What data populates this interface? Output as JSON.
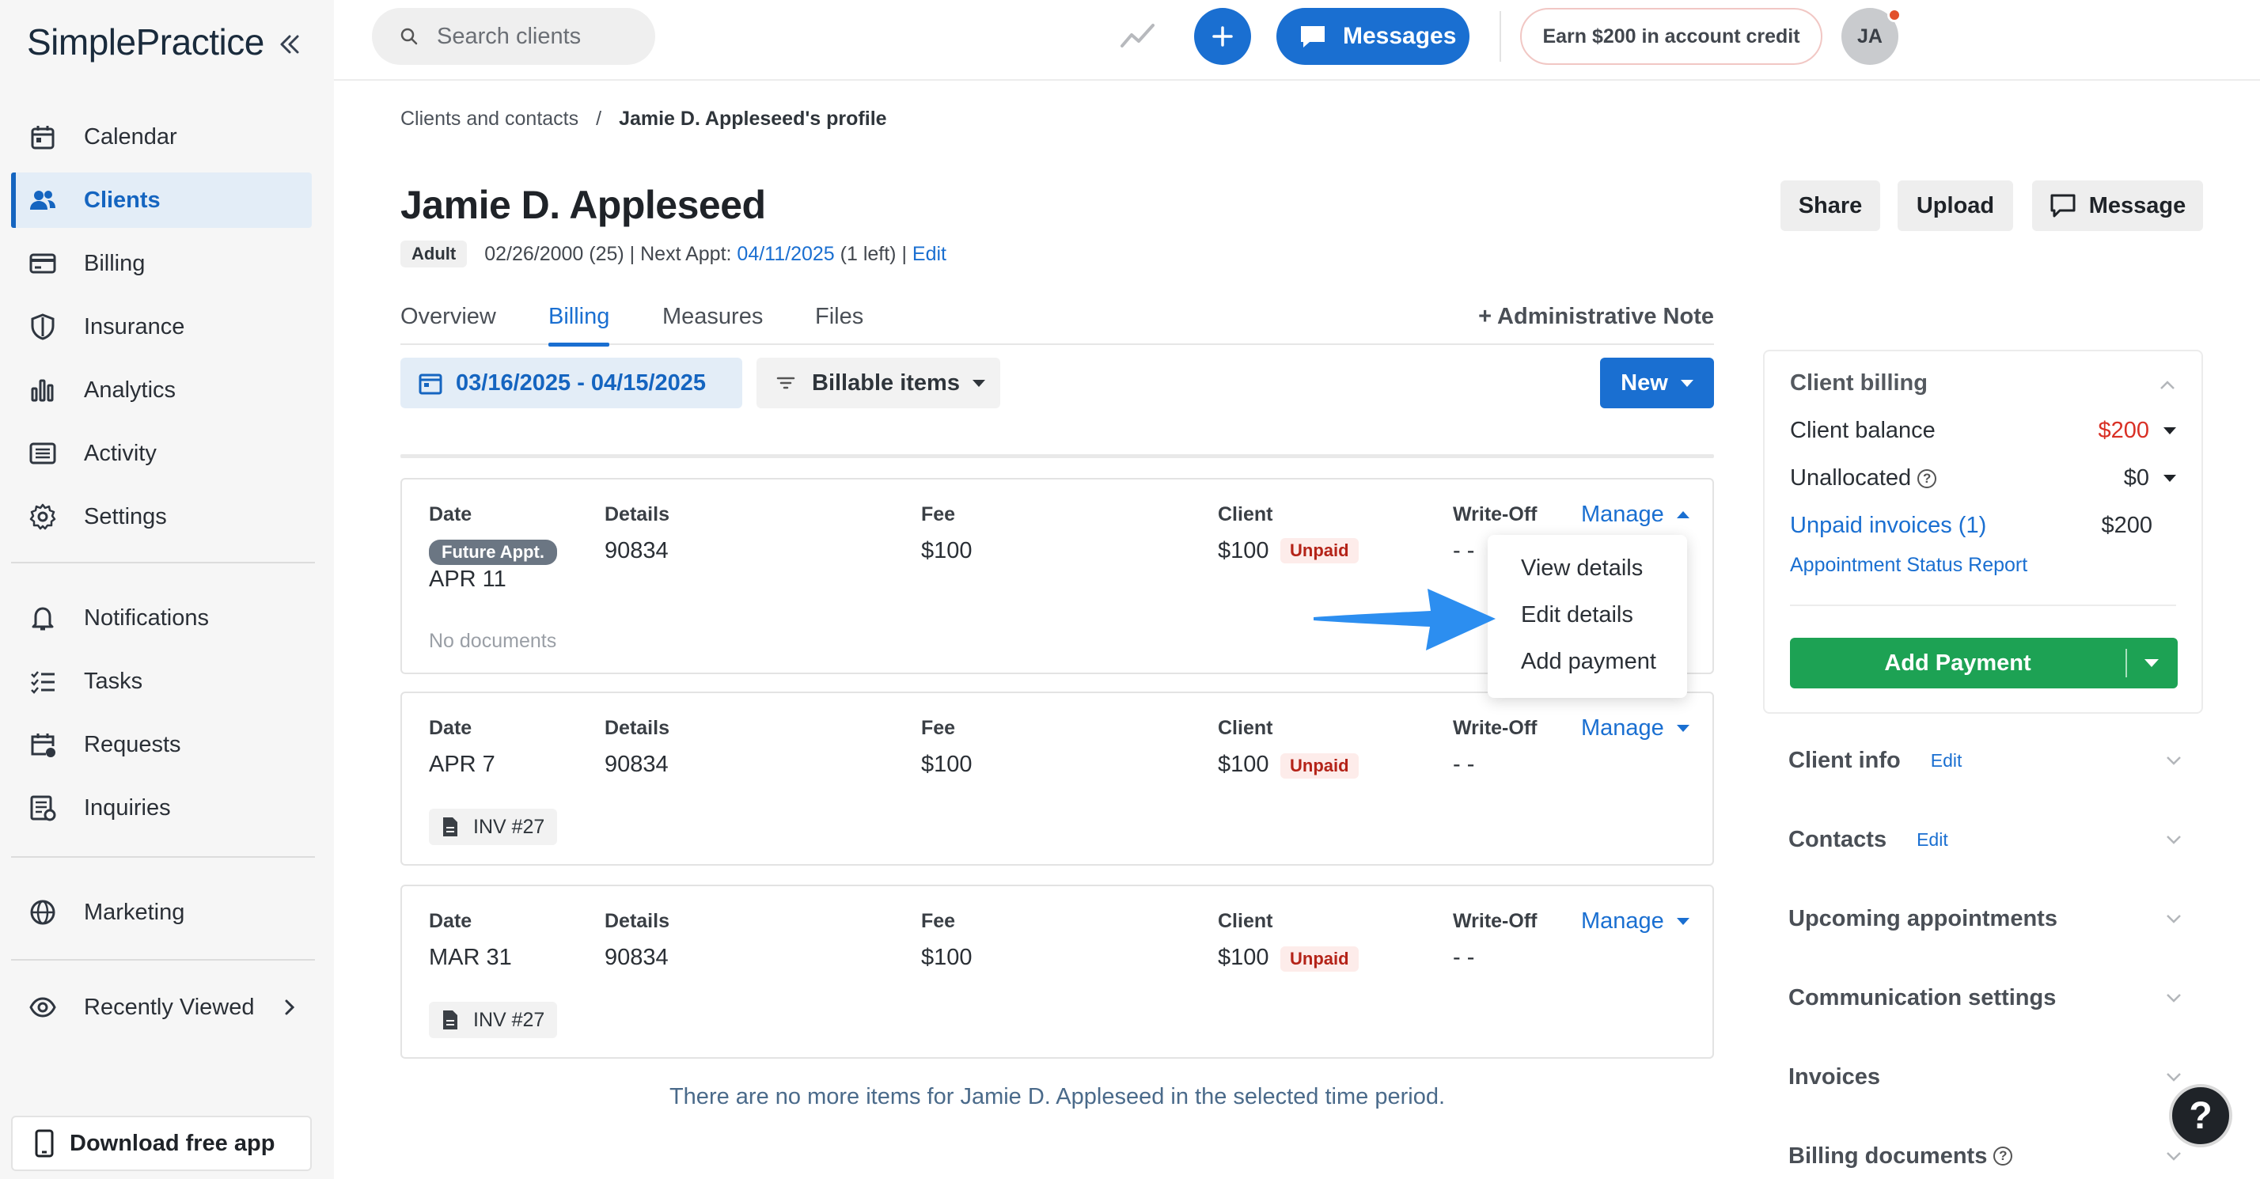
{
  "app": {
    "logo": "SimplePractice"
  },
  "sidebar": {
    "items": [
      {
        "label": "Calendar",
        "icon": "calendar-icon"
      },
      {
        "label": "Clients",
        "icon": "users-icon",
        "active": true
      },
      {
        "label": "Billing",
        "icon": "credit-card-icon"
      },
      {
        "label": "Insurance",
        "icon": "shield-icon"
      },
      {
        "label": "Analytics",
        "icon": "bar-chart-icon"
      },
      {
        "label": "Activity",
        "icon": "list-icon"
      },
      {
        "label": "Settings",
        "icon": "gear-icon"
      },
      {
        "label": "Notifications",
        "icon": "bell-icon"
      },
      {
        "label": "Tasks",
        "icon": "checklist-icon"
      },
      {
        "label": "Requests",
        "icon": "calendar-plus-icon"
      },
      {
        "label": "Inquiries",
        "icon": "inquiry-icon"
      },
      {
        "label": "Marketing",
        "icon": "globe-icon"
      },
      {
        "label": "Recently Viewed",
        "icon": "eye-icon"
      }
    ],
    "download_app": "Download free app"
  },
  "topbar": {
    "search_placeholder": "Search clients",
    "messages_label": "Messages",
    "earn_label": "Earn $200 in account credit",
    "avatar_initials": "JA"
  },
  "breadcrumb": {
    "parent": "Clients and contacts",
    "separator": "/",
    "current": "Jamie D. Appleseed's profile"
  },
  "client": {
    "name": "Jamie D. Appleseed",
    "badge": "Adult",
    "dob": "02/26/2000 (25) | Next Appt:",
    "next_appt": "04/11/2025",
    "left": "(1 left) |",
    "edit": "Edit"
  },
  "header_buttons": {
    "share": "Share",
    "upload": "Upload",
    "message": "Message"
  },
  "tabs": [
    {
      "label": "Overview"
    },
    {
      "label": "Billing",
      "active": true
    },
    {
      "label": "Measures"
    },
    {
      "label": "Files"
    }
  ],
  "admin_note": "+ Administrative Note",
  "filters": {
    "date_range": "03/16/2025 - 04/15/2025",
    "billable_items": "Billable items",
    "new": "New"
  },
  "columns": {
    "date": "Date",
    "details": "Details",
    "fee": "Fee",
    "client": "Client",
    "writeoff": "Write-Off",
    "manage": "Manage"
  },
  "billing_items": [
    {
      "badge": "Future Appt.",
      "date": "APR 11",
      "details": "90834",
      "fee": "$100",
      "client": "$100",
      "status": "Unpaid",
      "writeoff": "- -",
      "docs": "No documents"
    },
    {
      "date": "APR 7",
      "details": "90834",
      "fee": "$100",
      "client": "$100",
      "status": "Unpaid",
      "writeoff": "- -",
      "invoice": "INV #27"
    },
    {
      "date": "MAR 31",
      "details": "90834",
      "fee": "$100",
      "client": "$100",
      "status": "Unpaid",
      "writeoff": "- -",
      "invoice": "INV #27"
    }
  ],
  "manage_menu": {
    "items": [
      "View details",
      "Edit details",
      "Add payment"
    ]
  },
  "empty_message": "There are no more items for Jamie D. Appleseed in the selected time period.",
  "client_billing": {
    "title": "Client billing",
    "balance_label": "Client balance",
    "balance_value": "$200",
    "unallocated_label": "Unallocated",
    "unallocated_value": "$0",
    "unpaid_label": "Unpaid invoices (1)",
    "unpaid_value": "$200",
    "status_report": "Appointment Status Report",
    "add_payment": "Add Payment"
  },
  "right_sections": [
    {
      "label": "Client info",
      "edit": "Edit"
    },
    {
      "label": "Contacts",
      "edit": "Edit"
    },
    {
      "label": "Upcoming appointments"
    },
    {
      "label": "Communication settings"
    },
    {
      "label": "Invoices"
    },
    {
      "label": "Billing documents"
    }
  ],
  "colors": {
    "accent": "#1a6fd1",
    "green": "#1da254",
    "danger": "#d93025",
    "active_bg": "#e3edf7"
  }
}
